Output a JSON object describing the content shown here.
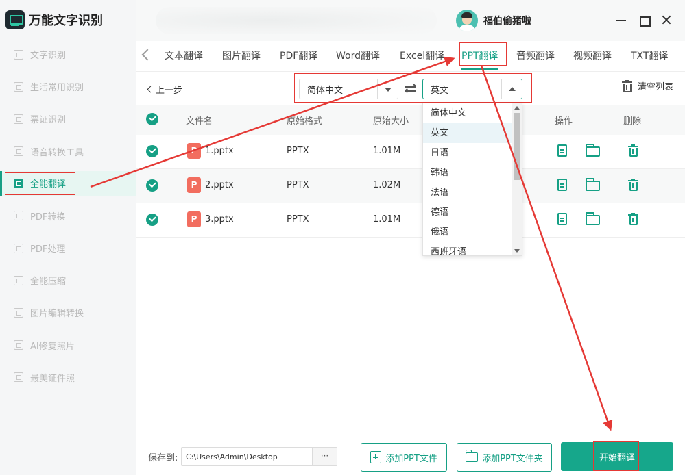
{
  "app": {
    "title": "万能文字识别"
  },
  "user": {
    "name": "福伯偷猪啦"
  },
  "sidebar": {
    "items": [
      {
        "label": "文字识别",
        "active": false
      },
      {
        "label": "生活常用识别",
        "active": false
      },
      {
        "label": "票证识别",
        "active": false
      },
      {
        "label": "语音转换工具",
        "active": false
      },
      {
        "label": "全能翻译",
        "active": true
      },
      {
        "label": "PDF转换",
        "active": false
      },
      {
        "label": "PDF处理",
        "active": false
      },
      {
        "label": "全能压缩",
        "active": false
      },
      {
        "label": "图片编辑转换",
        "active": false
      },
      {
        "label": "AI修复照片",
        "active": false
      },
      {
        "label": "最美证件照",
        "active": false
      }
    ]
  },
  "tabs": [
    {
      "label": "文本翻译"
    },
    {
      "label": "图片翻译"
    },
    {
      "label": "PDF翻译"
    },
    {
      "label": "Word翻译"
    },
    {
      "label": "Excel翻译"
    },
    {
      "label": "PPT翻译",
      "active": true
    },
    {
      "label": "音频翻译"
    },
    {
      "label": "视频翻译"
    },
    {
      "label": "TXT翻译"
    }
  ],
  "toolbar": {
    "back_label": "上一步",
    "source_lang": "简体中文",
    "target_lang": "英文",
    "clear_label": "清空列表"
  },
  "table": {
    "columns": {
      "name": "文件名",
      "format": "原始格式",
      "size": "原始大小",
      "actions": "操作",
      "delete": "删除"
    },
    "rows": [
      {
        "icon_letter": "P",
        "name": "1.pptx",
        "format": "PPTX",
        "size": "1.01M"
      },
      {
        "icon_letter": "P",
        "name": "2.pptx",
        "format": "PPTX",
        "size": "1.02M"
      },
      {
        "icon_letter": "P",
        "name": "3.pptx",
        "format": "PPTX",
        "size": "1.01M"
      }
    ]
  },
  "dropdown": {
    "options": [
      "简体中文",
      "英文",
      "日语",
      "韩语",
      "法语",
      "德语",
      "俄语",
      "西班牙语"
    ],
    "selected": "英文"
  },
  "footer": {
    "save_label": "保存到:",
    "save_path": "C:\\Users\\Admin\\Desktop",
    "browse_label": "···",
    "add_file_label": "添加PPT文件",
    "add_folder_label": "添加PPT文件夹",
    "start_label": "开始翻译"
  },
  "colors": {
    "accent": "#16a085",
    "annotation": "#e53935",
    "file_icon": "#f26d5f"
  }
}
